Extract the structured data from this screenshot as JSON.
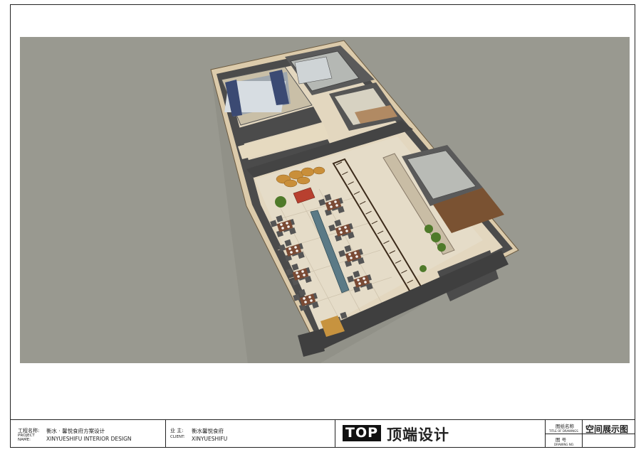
{
  "title_block": {
    "project_label_cn": "工程名称:",
    "project_label_en": "PROJECT NAME:",
    "project_name_cn": "衡水 · 馨悦食府方案设计",
    "project_name_en": "XINYUESHIFU  INTERIOR DESIGN",
    "client_label_cn": "业    主:",
    "client_label_en": "CLIENT:",
    "client_name_cn": "衡水馨悦食府",
    "client_name_en": "XINYUESHIFU",
    "logo_text": "TOP",
    "logo_cn": "顶端设计",
    "drawing_title_label_cn": "图纸名称",
    "drawing_title_label_en": "TITLE OF DRAWINGS",
    "drawing_no_label_cn": "图    号",
    "drawing_no_label_en": "DRAWING NO.",
    "drawing_title": "空间展示图"
  },
  "colors": {
    "background": "#999990",
    "wall_dark": "#4a4a4a",
    "wall_top": "#d8c8a8",
    "floor": "#e2d8c2",
    "table": "#7a4a34",
    "chair": "#555555"
  }
}
